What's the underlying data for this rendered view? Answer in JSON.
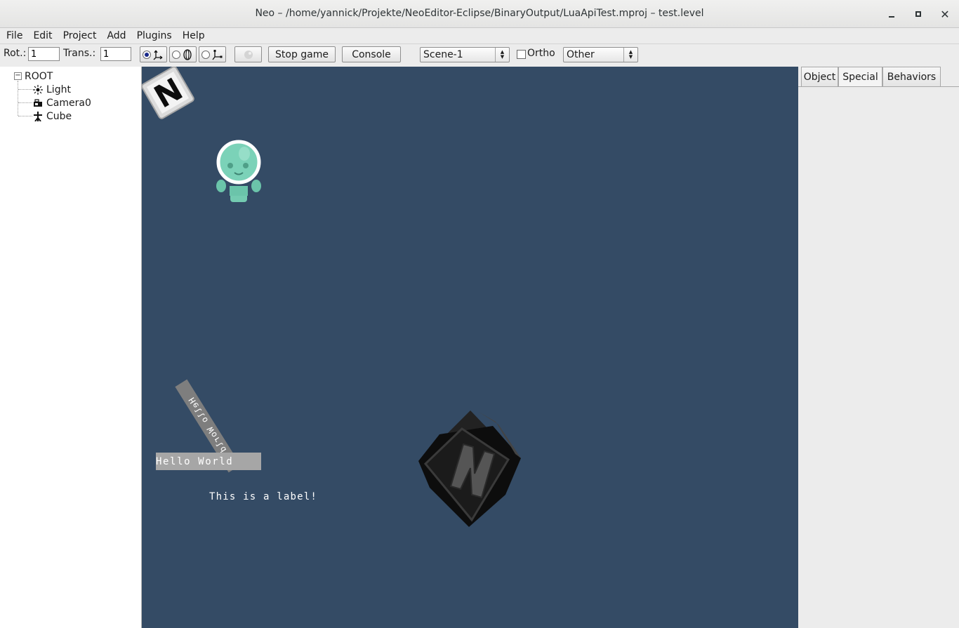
{
  "window": {
    "title": "Neo – /home/yannick/Projekte/NeoEditor-Eclipse/BinaryOutput/LuaApiTest.mproj – test.level"
  },
  "menu": [
    "File",
    "Edit",
    "Project",
    "Add",
    "Plugins",
    "Help"
  ],
  "toolbar": {
    "rot_label": "Rot.:",
    "rot_value": "1",
    "trans_label": "Trans.:",
    "trans_value": "1",
    "stop_game_label": "Stop game",
    "console_label": "Console",
    "scene_select": "Scene-1",
    "ortho_label": "Ortho",
    "ortho_checked": false,
    "view_select": "Other"
  },
  "tree": {
    "root": "ROOT",
    "items": [
      {
        "label": "Light",
        "icon": "light-icon"
      },
      {
        "label": "Camera0",
        "icon": "camera-icon"
      },
      {
        "label": "Cube",
        "icon": "entity-icon"
      }
    ]
  },
  "viewport": {
    "background": "#344b65",
    "hello_world": "Hello World",
    "rotated_text": "Hello World",
    "label_text": "This is a label!",
    "logo_letter": "N"
  },
  "right_panel": {
    "tabs": [
      "Object",
      "Special",
      "Behaviors"
    ]
  }
}
